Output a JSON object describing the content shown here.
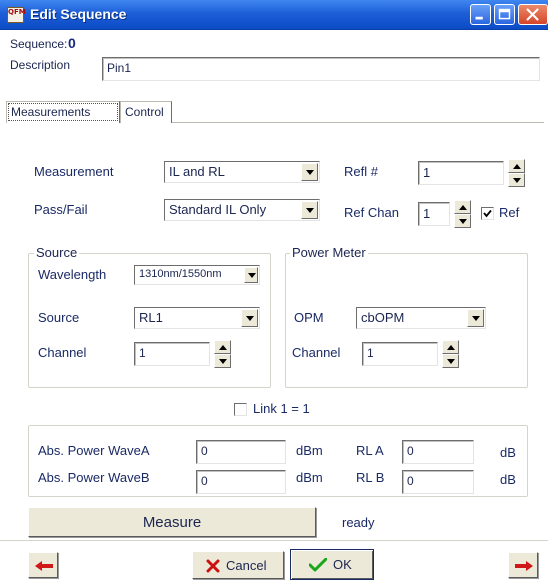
{
  "window": {
    "title": "Edit Sequence",
    "app_icon_text": "QFM"
  },
  "header": {
    "sequence_label": "Sequence:",
    "sequence_value": "0",
    "description_label": "Description",
    "description_value": "Pin1"
  },
  "tabs": [
    {
      "label": "Measurements",
      "active": true
    },
    {
      "label": "Control",
      "active": false
    }
  ],
  "measurements": {
    "measurement_label": "Measurement",
    "measurement_value": "IL and RL",
    "passfail_label": "Pass/Fail",
    "passfail_value": "Standard IL Only",
    "refl_label": "Refl #",
    "refl_value": "1",
    "refchan_label": "Ref Chan",
    "refchan_value": "1",
    "ref_checkbox_label": "Ref",
    "ref_checked": true
  },
  "source_group": {
    "title": "Source",
    "wavelength_label": "Wavelength",
    "wavelength_value": "1310nm/1550nm",
    "source_label": "Source",
    "source_value": "RL1",
    "channel_label": "Channel",
    "channel_value": "1"
  },
  "power_meter_group": {
    "title": "Power Meter",
    "opm_label": "OPM",
    "opm_value": "cbOPM",
    "channel_label": "Channel",
    "channel_value": "1"
  },
  "link": {
    "label": "Link 1 = 1",
    "checked": false
  },
  "readings": {
    "abs_wave_a_label": "Abs. Power WaveA",
    "abs_wave_a_value": "0",
    "abs_wave_a_unit": "dBm",
    "abs_wave_b_label": "Abs. Power WaveB",
    "abs_wave_b_value": "0",
    "abs_wave_b_unit": "dBm",
    "rl_a_label": "RL A",
    "rl_a_value": "0",
    "rl_a_unit": "dB",
    "rl_b_label": "RL B",
    "rl_b_value": "0",
    "rl_b_unit": "dB"
  },
  "measure": {
    "button_label": "Measure",
    "status": "ready"
  },
  "footer": {
    "cancel_label": "Cancel",
    "ok_label": "OK"
  },
  "colors": {
    "titlebar": "#1e5fd8",
    "dialog_bg": "#ffffff",
    "button_face": "#ece9d8",
    "label_text": "#1a2a66",
    "arrow_red": "#d01818",
    "ok_check_green": "#1aa51a",
    "cancel_x_red": "#cc1010"
  },
  "icons": [
    "app-icon",
    "minimize-icon",
    "maximize-icon",
    "close-icon",
    "dropdown-arrow-icon",
    "spin-up-icon",
    "spin-down-icon",
    "checkmark-icon",
    "x-icon",
    "arrow-left-icon",
    "arrow-right-icon"
  ]
}
